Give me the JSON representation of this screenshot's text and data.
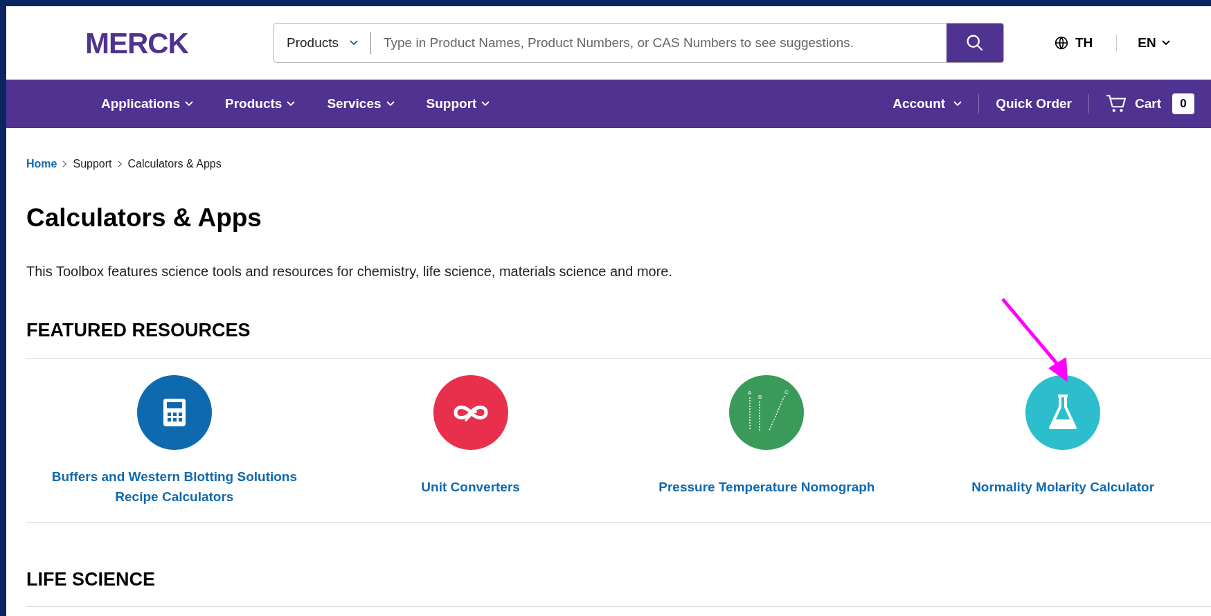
{
  "header": {
    "logo": "MERCK",
    "search": {
      "category": "Products",
      "placeholder": "Type in Product Names, Product Numbers, or CAS Numbers to see suggestions."
    },
    "country": "TH",
    "language": "EN"
  },
  "nav": {
    "items": [
      "Applications",
      "Products",
      "Services",
      "Support"
    ],
    "account": "Account",
    "quick_order": "Quick Order",
    "cart": {
      "label": "Cart",
      "count": "0"
    }
  },
  "breadcrumb": [
    "Home",
    "Support",
    "Calculators & Apps"
  ],
  "title": "Calculators & Apps",
  "description": "This Toolbox features science tools and resources for chemistry, life science, materials science and more.",
  "sections": [
    {
      "heading": "FEATURED RESOURCES",
      "resources": [
        {
          "kind": "calculator",
          "color": "#0f69af",
          "label": "Buffers and Western Blotting Solutions Recipe Calculators"
        },
        {
          "kind": "converter",
          "color": "#e8304d",
          "label": "Unit Converters"
        },
        {
          "kind": "nomograph",
          "color": "#3a9a5a",
          "label": "Pressure Temperature Nomograph",
          "marks": [
            "A",
            "B",
            "C"
          ]
        },
        {
          "kind": "flask",
          "color": "#2dbecd",
          "label": "Normality Molarity Calculator",
          "pointed": true
        }
      ]
    },
    {
      "heading": "LIFE SCIENCE"
    }
  ]
}
